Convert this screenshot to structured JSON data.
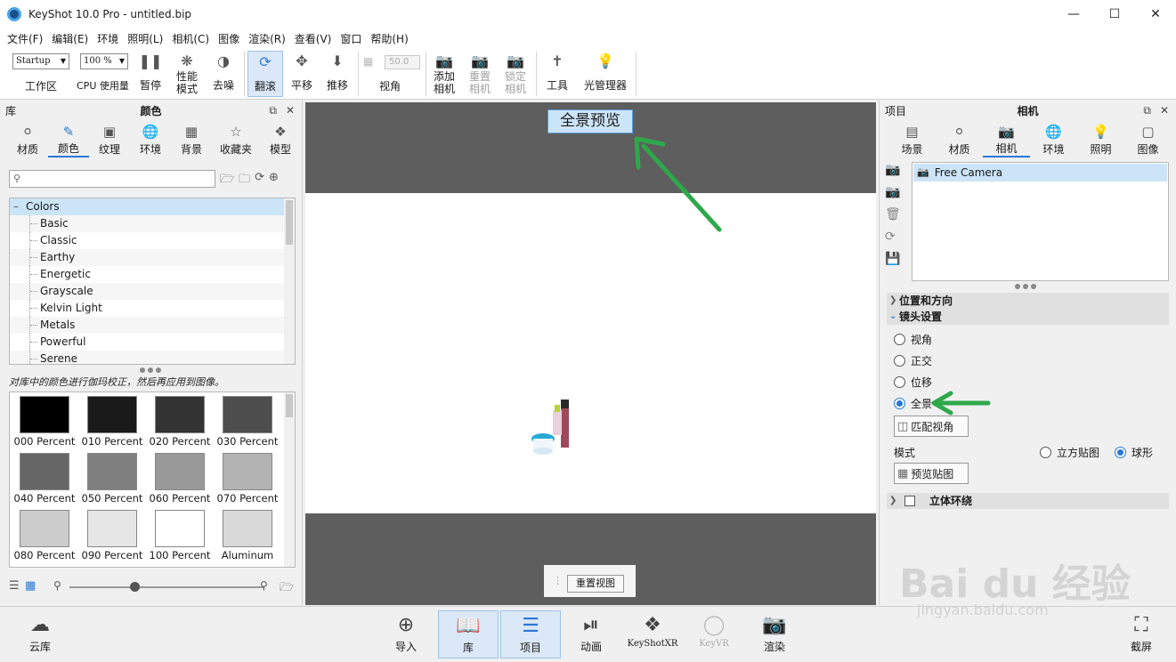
{
  "window": {
    "title": "KeyShot 10.0 Pro  - untitled.bip"
  },
  "menu": [
    "文件(F)",
    "编辑(E)",
    "环境",
    "照明(L)",
    "相机(C)",
    "图像",
    "渲染(R)",
    "查看(V)",
    "窗口",
    "帮助(H)"
  ],
  "toolbar": {
    "workspace_value": "Startup",
    "workspace_label": "工作区",
    "cpu_value": "100 %",
    "cpu_label": "CPU 使用量",
    "pause": "暂停",
    "perf_mode": "性能\n模式",
    "denoise": "去噪",
    "tumble": "翻滚",
    "pan": "平移",
    "dolly": "推移",
    "fov_value": "50.0",
    "fov_label": "视角",
    "add_camera": "添加\n相机",
    "reset_camera": "重置\n相机",
    "lock_camera": "锁定\n相机",
    "tools": "工具",
    "light_manager": "光管理器"
  },
  "library": {
    "header_left": "库",
    "header_title": "颜色",
    "tabs": [
      "材质",
      "颜色",
      "纹理",
      "环境",
      "背景",
      "收藏夹",
      "模型"
    ],
    "active_tab": "颜色",
    "search_placeholder": "",
    "tree_root": "Colors",
    "tree_items": [
      "Basic",
      "Classic",
      "Earthy",
      "Energetic",
      "Grayscale",
      "Kelvin Light",
      "Metals",
      "Powerful",
      "Serene"
    ],
    "hint": "对库中的颜色进行伽玛校正，然后再应用到图像。",
    "swatches": [
      {
        "name": "000 Percent",
        "color": "#000000"
      },
      {
        "name": "010 Percent",
        "color": "#1a1a1a"
      },
      {
        "name": "020 Percent",
        "color": "#333333"
      },
      {
        "name": "030 Percent",
        "color": "#4d4d4d"
      },
      {
        "name": "040 Percent",
        "color": "#666666"
      },
      {
        "name": "050 Percent",
        "color": "#7f7f7f"
      },
      {
        "name": "060 Percent",
        "color": "#999999"
      },
      {
        "name": "070 Percent",
        "color": "#b3b3b3"
      },
      {
        "name": "080 Percent",
        "color": "#cccccc"
      },
      {
        "name": "090 Percent",
        "color": "#e6e6e6"
      },
      {
        "name": "100 Percent",
        "color": "#ffffff"
      },
      {
        "name": "Aluminum",
        "color": "#d9d9d9"
      }
    ]
  },
  "viewport": {
    "panorama_label": "全景预览",
    "reset_view": "重置视图"
  },
  "project": {
    "header_left": "项目",
    "header_title": "相机",
    "tabs": [
      "场景",
      "材质",
      "相机",
      "环境",
      "照明",
      "图像"
    ],
    "active_tab": "相机",
    "camera_item": "Free Camera",
    "section_position": "位置和方向",
    "section_lens": "镜头设置",
    "lens_options": [
      "视角",
      "正交",
      "位移",
      "全景"
    ],
    "selected_lens": "全景",
    "match_view": "匹配视角",
    "mode_label": "模式",
    "mode_cube": "立方贴图",
    "mode_sphere": "球形",
    "selected_mode": "球形",
    "preview_map": "预览贴图",
    "section_stereo": "立体环绕"
  },
  "bottombar": {
    "cloud": "云库",
    "import": "导入",
    "library": "库",
    "project": "项目",
    "animation": "动画",
    "keyshotxr": "KeyShotXR",
    "keyvr": "KeyVR",
    "render": "渲染",
    "screenshot": "截屏"
  },
  "watermark": {
    "main": "Bai du 经验",
    "sub": "jingyan.baidu.com"
  },
  "colors": {
    "accent": "#2a78d4",
    "arrow": "#2ea84a",
    "viewport_bg": "#5e5e5e"
  }
}
